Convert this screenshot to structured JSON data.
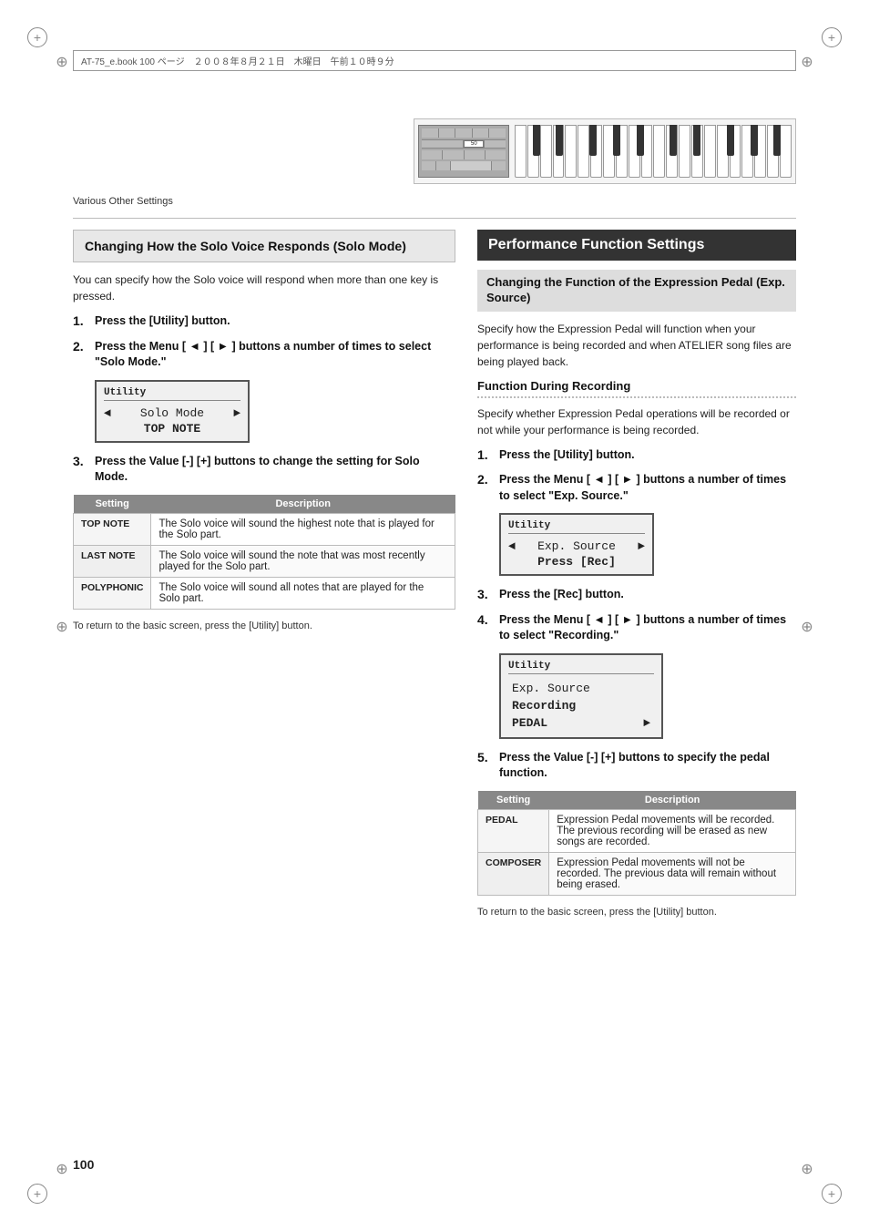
{
  "page": {
    "number": "100",
    "header_text": "AT-75_e.book  100 ページ　２００８年８月２１日　木曜日　午前１０時９分"
  },
  "section_label": "Various Other Settings",
  "left": {
    "section_title": "Changing How the Solo Voice Responds (Solo Mode)",
    "intro": "You can specify how the Solo voice will respond when more than one key is pressed.",
    "steps": [
      {
        "num": "1.",
        "text": "Press the [Utility] button."
      },
      {
        "num": "2.",
        "text": "Press the Menu [ ◄ ] [ ► ] buttons a number of times to select \"Solo Mode.\""
      },
      {
        "num": "3.",
        "text": "Press the Value [-] [+] buttons to change the setting for Solo Mode."
      }
    ],
    "utility_box_1": {
      "title": "Utility",
      "row_left": "◄",
      "row_center": "Solo Mode",
      "row_right": "►",
      "sub": "TOP NOTE"
    },
    "table": {
      "headers": [
        "Setting",
        "Description"
      ],
      "rows": [
        {
          "setting": "TOP NOTE",
          "description": "The Solo voice will sound the highest note that is played for the Solo part."
        },
        {
          "setting": "LAST NOTE",
          "description": "The Solo voice will sound the note that was most recently played for the Solo part."
        },
        {
          "setting": "POLYPHONIC",
          "description": "The Solo voice will sound all notes that are played for the Solo part."
        }
      ]
    },
    "note": "To return to the basic screen, press the [Utility] button."
  },
  "right": {
    "section_title": "Performance Function Settings",
    "subsection_title": "Changing the Function of the Expression Pedal (Exp. Source)",
    "intro": "Specify how the Expression Pedal will function when your performance is being recorded and when ATELIER song files are being played back.",
    "func_heading": "Function During Recording",
    "func_intro": "Specify whether Expression Pedal operations will be recorded or not while your performance is being recorded.",
    "steps": [
      {
        "num": "1.",
        "text": "Press the [Utility] button."
      },
      {
        "num": "2.",
        "text": "Press the Menu [ ◄ ] [ ► ] buttons a number of times to select \"Exp. Source.\""
      },
      {
        "num": "3.",
        "text": "Press the [Rec] button."
      },
      {
        "num": "4.",
        "text": "Press the Menu [ ◄ ] [ ► ] buttons a number of times to select \"Recording.\""
      },
      {
        "num": "5.",
        "text": "Press the Value [-] [+] buttons to specify the pedal function."
      }
    ],
    "utility_box_2": {
      "title": "Utility",
      "row_left": "◄",
      "row_center": "Exp. Source",
      "row_right": "►",
      "sub": "Press [Rec]"
    },
    "utility_box_3": {
      "title": "Utility",
      "line1": "Exp. Source",
      "line2": "Recording",
      "line3": "PEDAL",
      "arrow": "►"
    },
    "table": {
      "headers": [
        "Setting",
        "Description"
      ],
      "rows": [
        {
          "setting": "PEDAL",
          "description": "Expression Pedal movements will be recorded. The previous recording will be erased as new songs are recorded."
        },
        {
          "setting": "COMPOSER",
          "description": "Expression Pedal movements will not be recorded. The previous data will remain without being erased."
        }
      ]
    },
    "note": "To return to the basic screen, press the [Utility] button."
  }
}
